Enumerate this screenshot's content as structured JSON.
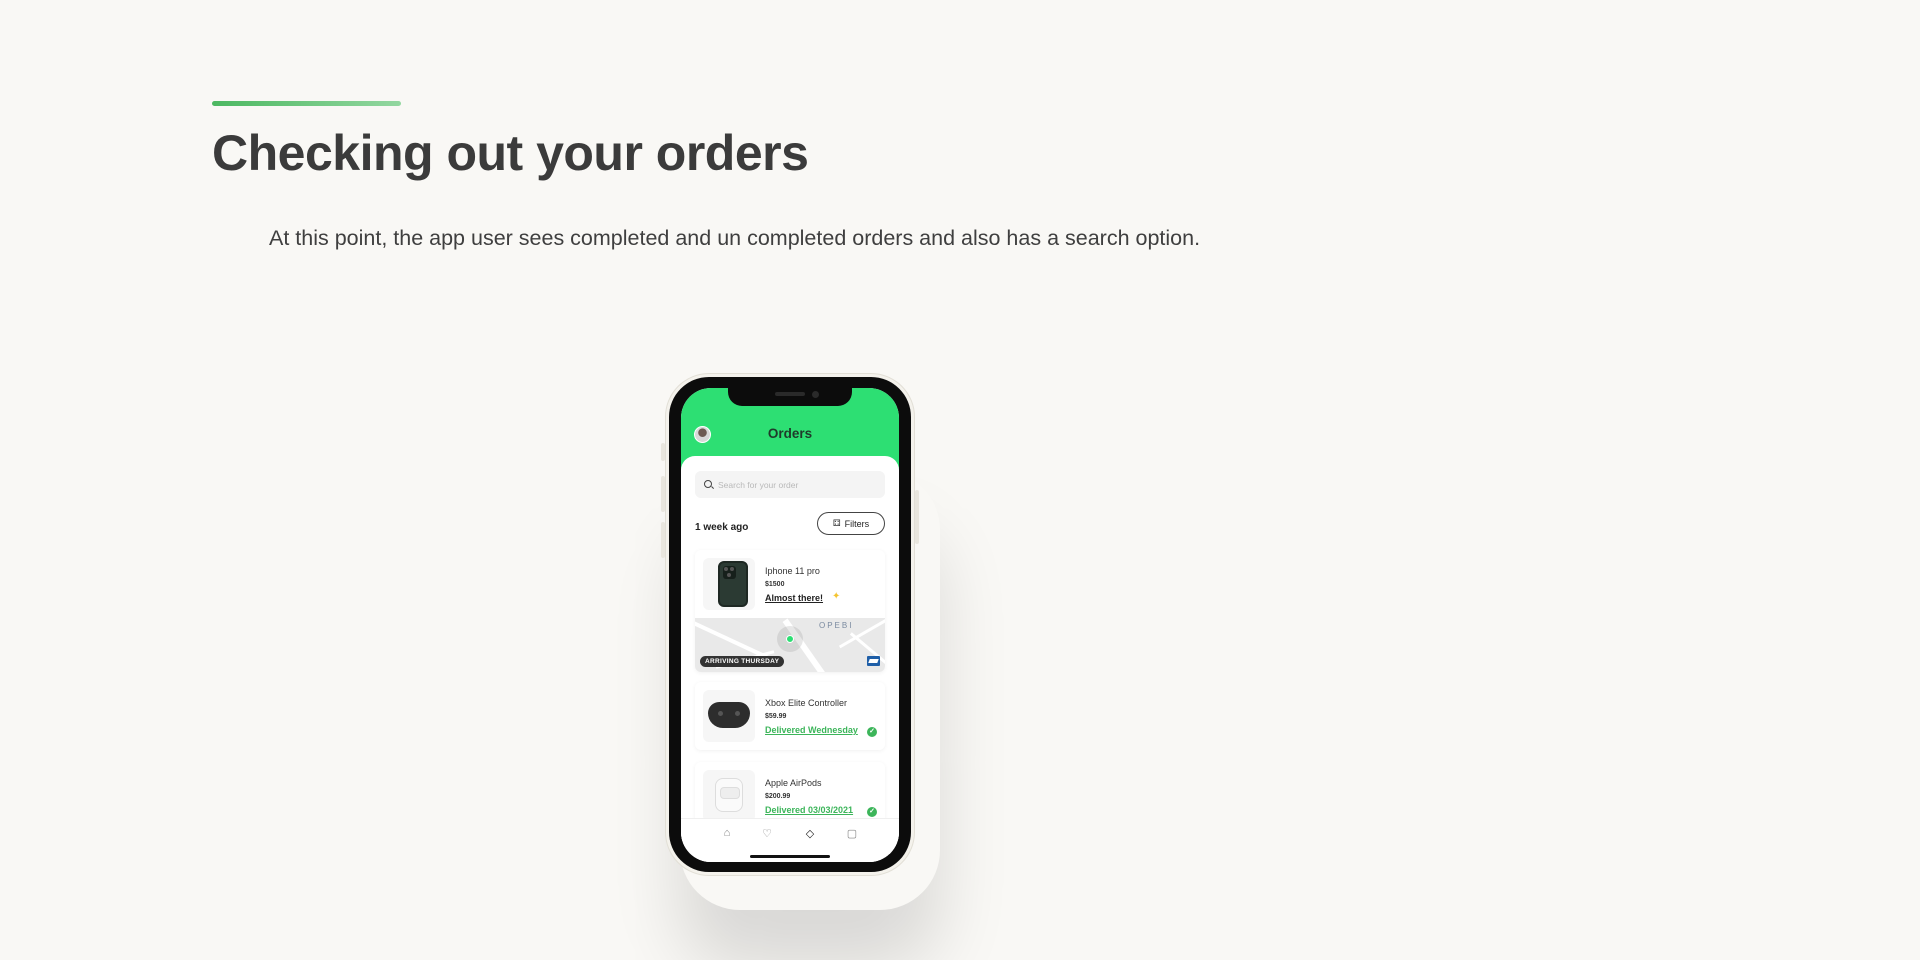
{
  "page": {
    "title": "Checking out your orders",
    "description": "At this point, the app user sees completed and un completed orders and also has a search option."
  },
  "app": {
    "header_title": "Orders",
    "search_placeholder": "Search for your order",
    "section_label": "1 week ago",
    "filters_label": "Filters",
    "filters_icon": "⚃",
    "orders": [
      {
        "name": "Iphone 11 pro",
        "price": "$1500",
        "status": "Almost there!",
        "status_icon": "✦",
        "map": {
          "area_label": "OPEBI",
          "arriving_label": "ARRIVING THURSDAY"
        }
      },
      {
        "name": "Xbox Elite Controller",
        "price": "$59.99",
        "status": "Delivered Wednesday",
        "status_icon": "✓"
      },
      {
        "name": "Apple AirPods",
        "price": "$200.99",
        "status": "Delivered 03/03/2021",
        "status_icon": "✓"
      }
    ],
    "tabs": [
      {
        "name": "home-icon",
        "glyph": "⌂"
      },
      {
        "name": "heart-icon",
        "glyph": "♡"
      },
      {
        "name": "tag-icon",
        "glyph": "◇"
      },
      {
        "name": "bag-icon",
        "glyph": "▢"
      }
    ],
    "colors": {
      "header": "#2ddf73",
      "delivered": "#3cb55a",
      "accent_line_start": "#4cb861",
      "accent_line_end": "#93d7a0"
    }
  }
}
